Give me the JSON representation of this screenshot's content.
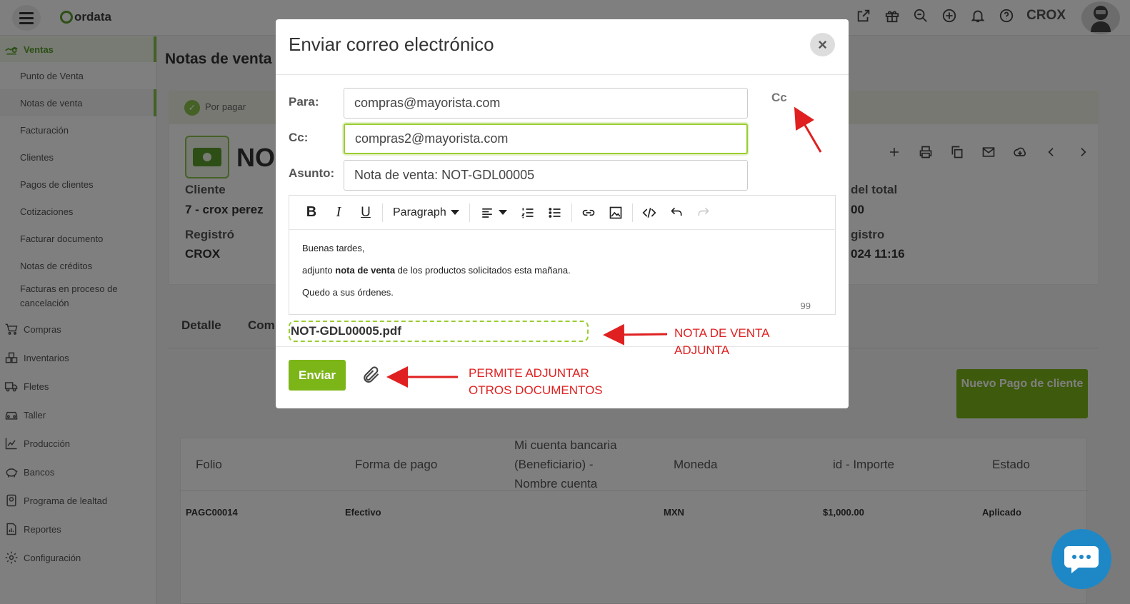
{
  "topbar": {
    "logo_text": "ordata",
    "user": "CROX"
  },
  "sidebar": {
    "items": [
      {
        "label": "Ventas",
        "icon": "sales-icon"
      },
      {
        "label": "Compras",
        "icon": "cart-icon"
      },
      {
        "label": "Inventarios",
        "icon": "inventory-icon"
      },
      {
        "label": "Fletes",
        "icon": "truck-icon"
      },
      {
        "label": "Taller",
        "icon": "car-icon"
      },
      {
        "label": "Producción",
        "icon": "chart-icon"
      },
      {
        "label": "Bancos",
        "icon": "piggy-icon"
      },
      {
        "label": "Programa de lealtad",
        "icon": "gift-card-icon"
      },
      {
        "label": "Reportes",
        "icon": "report-icon"
      },
      {
        "label": "Configuración",
        "icon": "gear-icon"
      }
    ],
    "sub_items": [
      "Punto de Venta",
      "Notas de venta",
      "Facturación",
      "Clientes",
      "Pagos de clientes",
      "Cotizaciones",
      "Facturar documento",
      "Notas de créditos",
      "Facturas en proceso de cancelación"
    ]
  },
  "page": {
    "title": "Notas de venta",
    "status": "Por pagar",
    "doc_prefix": "NO",
    "client_label": "Cliente",
    "client_value": "7 - crox perez",
    "registered_label": "Registró",
    "registered_value": "CROX",
    "total_label": "del total",
    "total_value": "00",
    "date_label": "gistro",
    "date_value": "024 11:16",
    "tabs": [
      "Detalle",
      "Com"
    ],
    "new_payment": "Nuevo Pago de cliente"
  },
  "payments_table": {
    "headers": [
      "Folio",
      "Forma de pago",
      "Mi cuenta bancaria (Beneficiario) - Nombre cuenta",
      "Moneda",
      "id - Importe",
      "Estado"
    ],
    "rows": [
      [
        "PAGC00014",
        "Efectivo",
        "",
        "MXN",
        "$1,000.00",
        "Aplicado"
      ]
    ]
  },
  "modal": {
    "title": "Enviar correo electrónico",
    "to_label": "Para:",
    "to_value": "compras@mayorista.com",
    "cc_label": "Cc:",
    "cc_value": "compras2@mayorista.com",
    "subject_label": "Asunto:",
    "subject_value": "Nota de venta: NOT-GDL00005",
    "cc_link": "Cc",
    "editor": {
      "block_format": "Paragraph",
      "line1": "Buenas tardes,",
      "line2_pre": "adjunto ",
      "line2_bold": "nota de venta",
      "line2_post": " de los productos solicitados esta mañana.",
      "line3": "Quedo a sus órdenes.",
      "word_count": "99"
    },
    "attachment": "NOT-GDL00005.pdf",
    "send_label": "Enviar"
  },
  "annotations": {
    "attached_note": "NOTA DE VENTA ADJUNTA",
    "attach_more_note": "PERMITE ADJUNTAR OTROS DOCUMENTOS"
  },
  "colors": {
    "accent": "#7cb518",
    "annotation": "#e02020"
  }
}
